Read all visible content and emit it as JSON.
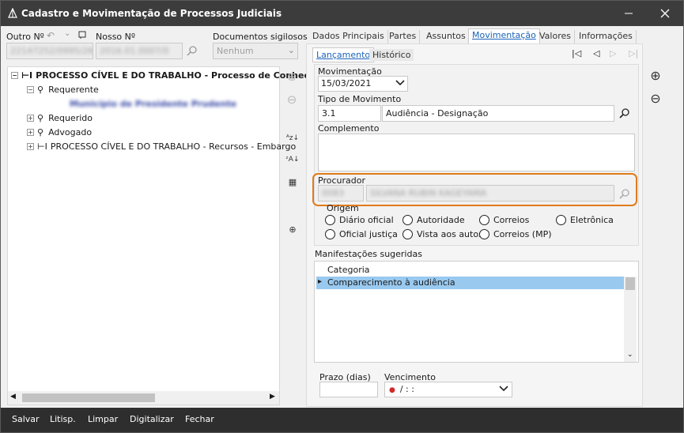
{
  "window": {
    "title": "Cadastro e Movimentação de Processos Judiciais"
  },
  "header": {
    "outro_label": "Outro Nº",
    "outro_value": "22147252/0995/260494",
    "nosso_label": "Nosso Nº",
    "nosso_value": "2016.01.0007/0",
    "sigilosos_label": "Documentos sigilosos",
    "sigilosos_value": "Nenhum"
  },
  "tabs": [
    "Dados Principais",
    "Partes",
    "Assuntos",
    "Movimentação",
    "Valores",
    "Informações"
  ],
  "subtabs": [
    "Lançamento",
    "Histórico"
  ],
  "tree": {
    "root": "PROCESSO CÍVEL E DO TRABALHO - Processo de Conhecim",
    "requerente": "Requerente",
    "requerente_child": "Município de Presidente Prudente",
    "requerido": "Requerido",
    "advogado": "Advogado",
    "recursos": "PROCESSO CÍVEL E DO TRABALHO - Recursos - Embargo"
  },
  "form": {
    "movimentacao_label": "Movimentação",
    "movimentacao_value": "15/03/2021",
    "tipo_label": "Tipo de Movimento",
    "tipo_code": "3.1",
    "tipo_desc": "Audiência - Designação",
    "complemento_label": "Complemento",
    "procurador_label": "Procurador",
    "procurador_code": "0083",
    "procurador_name": "SILVANA RUBIN KAGEYAMA",
    "origem_label": "Origem",
    "origem_options": [
      "Diário oficial",
      "Autoridade",
      "Correios",
      "Eletrônica",
      "Oficial justiça",
      "Vista aos autos",
      "Correios (MP)"
    ],
    "manifestacoes_label": "Manifestações sugeridas",
    "grid_header": "Categoria",
    "grid_row": "Comparecimento à audiência",
    "prazo_label": "Prazo (dias)",
    "vencimento_label": "Vencimento",
    "vencimento_value": "/    : :"
  },
  "footer": {
    "salvar": "Salvar",
    "litisp": "Litisp.",
    "limpar": "Limpar",
    "digitalizar": "Digitalizar",
    "fechar": "Fechar"
  },
  "colors": {
    "accent": "#e07b1a",
    "selection": "#99c9ef",
    "titlebar": "#3c3c3c"
  }
}
